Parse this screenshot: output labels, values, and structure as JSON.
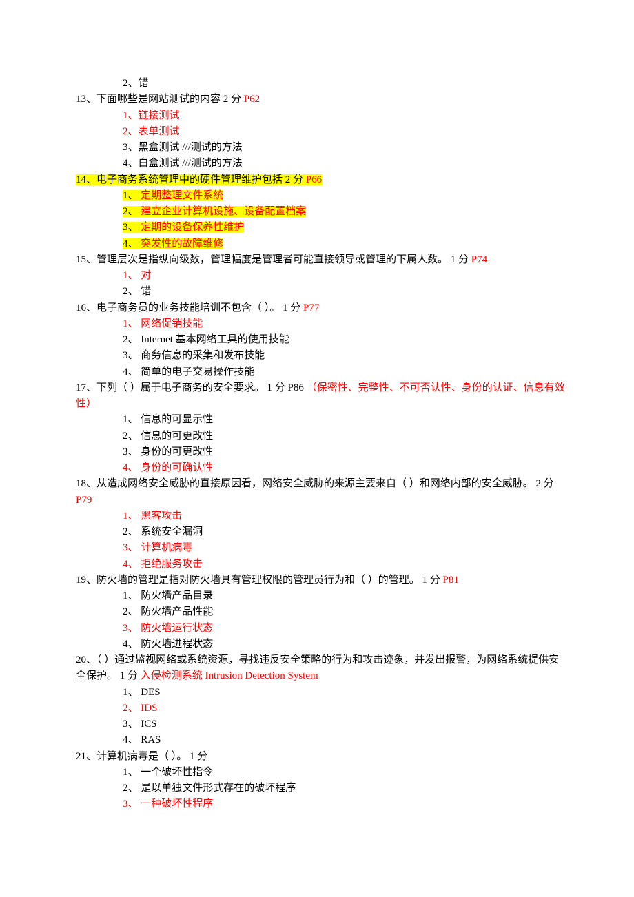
{
  "lines": {
    "q12_opt2": "2、错",
    "q13_stem_a": "13、下面哪些是网站测试的内容  2 分  ",
    "q13_stem_ref": "P62",
    "q13_opt1": "1、链接测试",
    "q13_opt2": "2、表单测试",
    "q13_opt3": "3、黑盒测试    ///测试的方法",
    "q13_opt4": "4、白盒测试    ///测试的方法",
    "q14_stem_a": "14、电子商务系统管理中的硬件管理维护包括  2 分  ",
    "q14_stem_ref": "P66",
    "q14_opt1_a": "1、 ",
    "q14_opt1_b": "定期整理文件系统",
    "q14_opt2_a": "2、 ",
    "q14_opt2_b": "建立企业计算机设施、设备配置档案",
    "q14_opt3_a": "3、 ",
    "q14_opt3_b": "定期的设备保养性维护",
    "q14_opt4_a": "4、 ",
    "q14_opt4_b": "突发性的故障维修",
    "q15_stem_a": "15、管理层次是指纵向级数，管理幅度是管理者可能直接领导或管理的下属人数。 1 分  ",
    "q15_stem_ref": "P74",
    "q15_opt1": "1、 对",
    "q15_opt2": "2、 错",
    "q16_stem_a": "16、电子商务员的业务技能培训不包含（ ）。 1 分  ",
    "q16_stem_ref": "P77",
    "q16_opt1": "1、 网络促销技能",
    "q16_opt2": "2、 Internet 基本网络工具的使用技能",
    "q16_opt3": "3、 商务信息的采集和发布技能",
    "q16_opt4": "4、 简单的电子交易操作技能",
    "q17_stem_a": "17、下列（ ）属于电子商务的安全要求。 1 分 P86 ",
    "q17_stem_note": "（保密性、完整性、不可否认性、身份的认证、信息有效性）",
    "q17_opt1": "1、 信息的可显示性",
    "q17_opt2": "2、 信息的可更改性",
    "q17_opt3": "3、 身份的可更改性",
    "q17_opt4": "4、 身份的可确认性",
    "q18_stem_a": "18、从造成网络安全威胁的直接原因看，网络安全威胁的来源主要来自（ ）和网络内部的安全威胁。 2 分  ",
    "q18_stem_ref": "P79",
    "q18_opt1": "1、 黑客攻击",
    "q18_opt2": "2、 系统安全漏洞",
    "q18_opt3": "3、 计算机病毒",
    "q18_opt4": "4、 拒绝服务攻击",
    "q19_stem_a": "19、防火墙的管理是指对防火墙具有管理权限的管理员行为和（ ）的管理。 1 分   ",
    "q19_stem_ref": "P81",
    "q19_opt1": "1、 防火墙产品目录",
    "q19_opt2": "2、 防火墙产品性能",
    "q19_opt3": "3、 防火墙运行状态",
    "q19_opt4": "4、 防火墙进程状态",
    "q20_stem_a": "20、（ ）通过监视网络或系统资源，寻找违反安全策略的行为和攻击迹象，并发出报警，为网络系统提供安全保护。 1 分  ",
    "q20_stem_note": "入侵检测系统 Intrusion Detection System",
    "q20_opt1": "1、 DES",
    "q20_opt2": "2、 IDS",
    "q20_opt3": "3、 ICS",
    "q20_opt4": "4、 RAS",
    "q21_stem_a": "21、计算机病毒是（ ）。 1 分",
    "q21_opt1": "1、 一个破坏性指令",
    "q21_opt2": "2、 是以单独文件形式存在的破坏程序",
    "q21_opt3": "3、 一种破坏性程序"
  }
}
